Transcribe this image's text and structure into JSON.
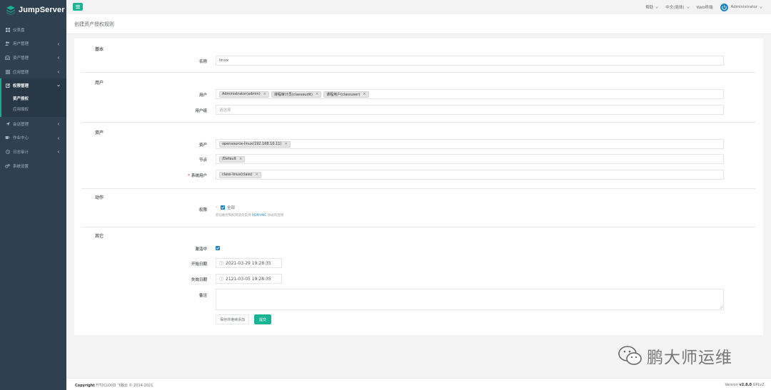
{
  "app": {
    "title": "JumpServer"
  },
  "sidebar": {
    "items": [
      {
        "label": "仪表盘",
        "icon": "dashboard-icon"
      },
      {
        "label": "用户管理",
        "icon": "users-icon"
      },
      {
        "label": "资产管理",
        "icon": "inbox-icon"
      },
      {
        "label": "应用管理",
        "icon": "th-icon"
      },
      {
        "label": "权限管理",
        "icon": "edit-icon"
      },
      {
        "label": "会话管理",
        "icon": "rocket-icon"
      },
      {
        "label": "作业中心",
        "icon": "coffee-icon"
      },
      {
        "label": "日志审计",
        "icon": "history-icon"
      },
      {
        "label": "系统设置",
        "icon": "gears-icon"
      }
    ],
    "sub_items": [
      {
        "label": "资产授权"
      },
      {
        "label": "应用授权"
      }
    ]
  },
  "topbar": {
    "help": "帮助",
    "language": "中文(简体)",
    "web_terminal": "Web终端",
    "user": "Administrator"
  },
  "page": {
    "title": "创建资产授权规则"
  },
  "form": {
    "basic": {
      "section": "基本",
      "name_label": "名称",
      "name_value": "linux"
    },
    "user": {
      "section": "用户",
      "users_label": "用户",
      "users": [
        "Administrator(admin)",
        "课程审计员(classaudit)",
        "课程用户(classuser)"
      ],
      "groups_label": "用户组",
      "groups_placeholder": "请选择"
    },
    "asset": {
      "section": "资产",
      "assets_label": "资产",
      "assets": [
        "opensource-linux(192.168.10.11)"
      ],
      "nodes_label": "节点",
      "nodes": [
        "/Default"
      ],
      "system_users_label": "系统用户",
      "system_users": [
        "class-linux(class)"
      ]
    },
    "action": {
      "section": "动作",
      "perm_label": "权限",
      "all_label": "全部",
      "help_text_prefix": "剪切板控制权目前仅支持",
      "help_text_link": "RDP/VNC",
      "help_text_suffix": "协议的连接"
    },
    "other": {
      "section": "其它",
      "active_label": "激活中",
      "start_label": "开始日期",
      "start_value": "2021-03-29 19:28:35",
      "end_label": "失效日期",
      "end_value": "2121-03-05 19:28:35",
      "comment_label": "备注"
    },
    "buttons": {
      "save_continue": "保存并继续添加",
      "submit": "提交"
    }
  },
  "watermark": {
    "text": "鹏大师运维"
  },
  "footer": {
    "copyright_bold": "Copyright",
    "copyright_text": "FIT2CLOUD 飞致云 © 2014-2021",
    "version_prefix": "Version",
    "version": "v2.8.0",
    "license": "GPLv2."
  },
  "colors": {
    "sidebar_bg": "#2f4050",
    "accent": "#1ab394",
    "link": "#1c84c6",
    "required": "#ed5565"
  }
}
